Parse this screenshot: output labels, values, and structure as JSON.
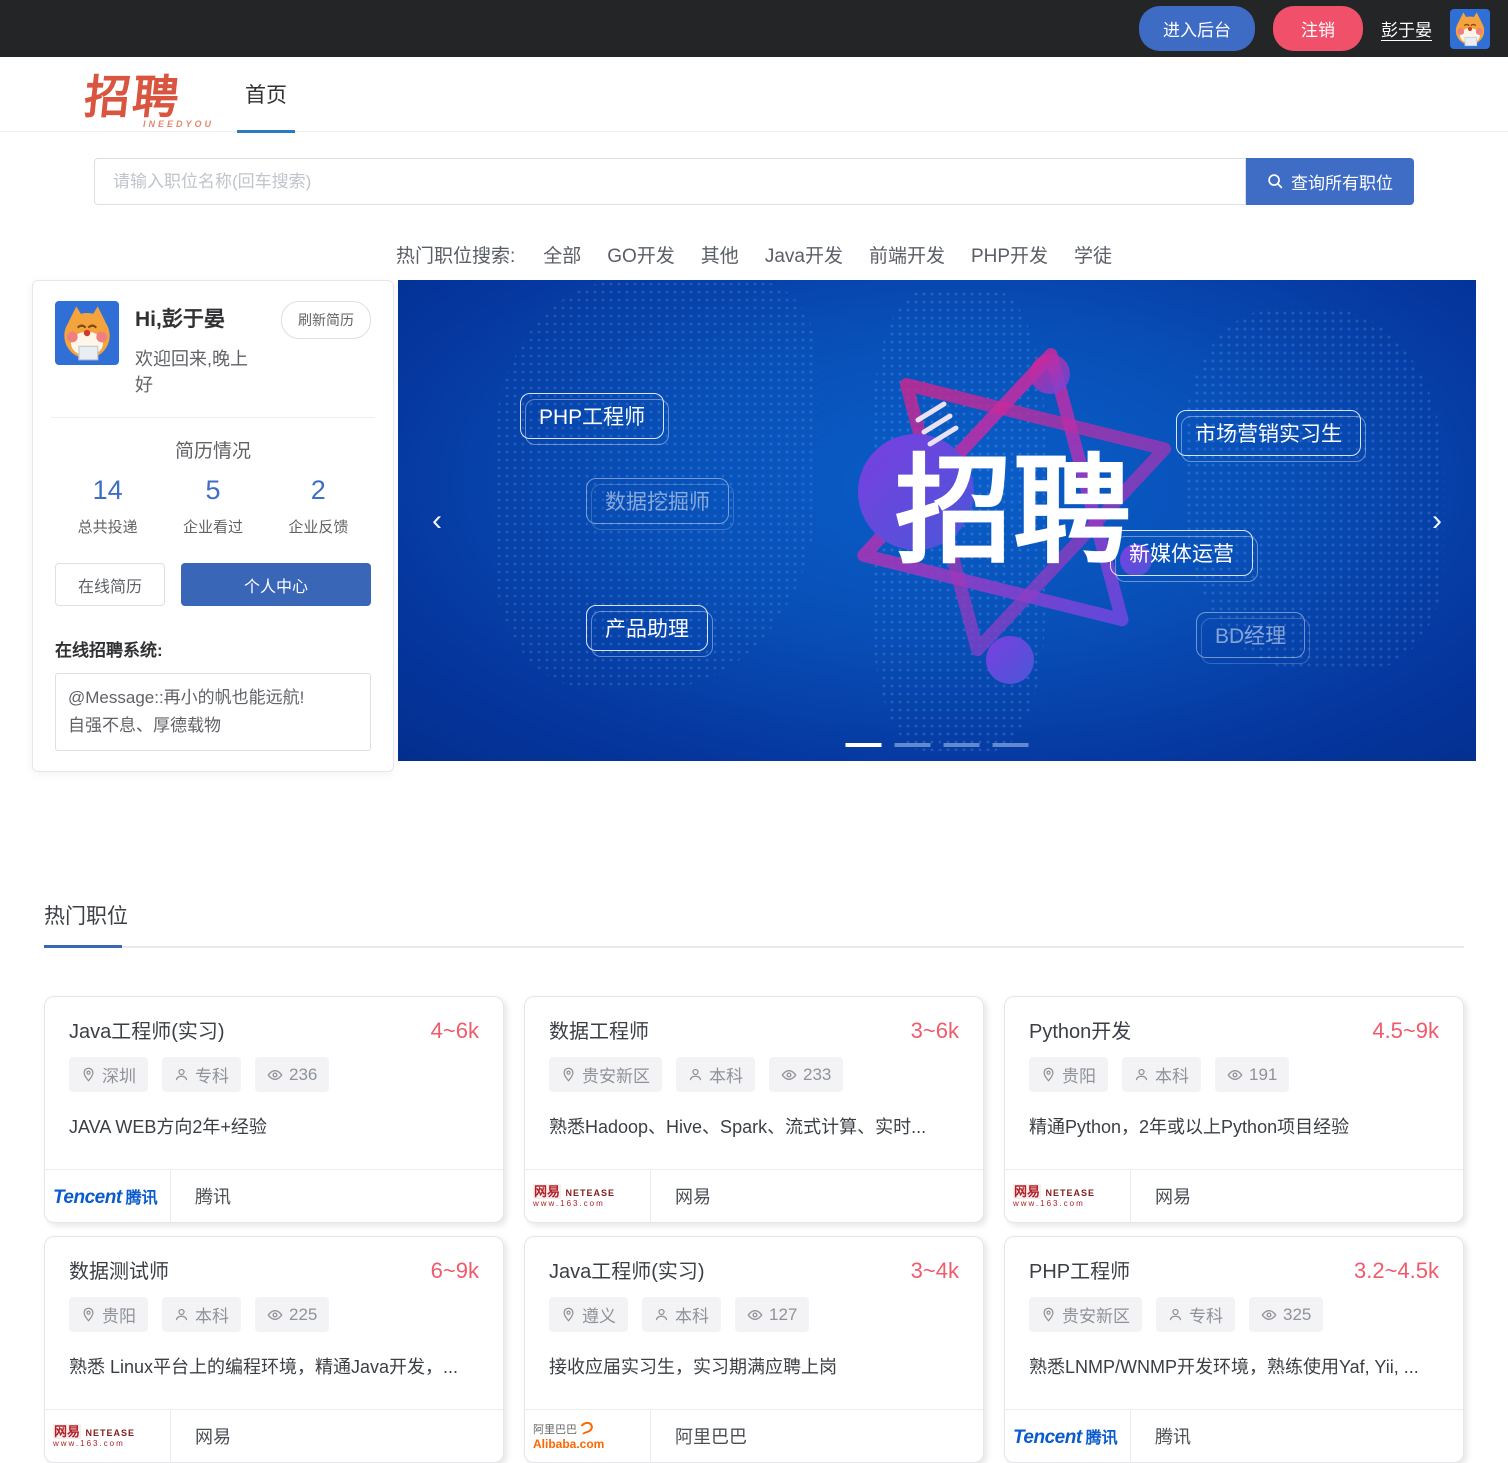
{
  "topbar": {
    "admin_button": "进入后台",
    "logout_button": "注销",
    "username": "彭于晏"
  },
  "header": {
    "logo_text": "招聘",
    "logo_sub": "INEEDYOU",
    "nav_home": "首页"
  },
  "search": {
    "placeholder": "请输入职位名称(回车搜索)",
    "button": "查询所有职位"
  },
  "hot_search": {
    "label": "热门职位搜索:",
    "items": [
      "全部",
      "GO开发",
      "其他",
      "Java开发",
      "前端开发",
      "PHP开发",
      "学徒"
    ]
  },
  "user_card": {
    "greeting": "Hi,彭于晏",
    "refresh_button": "刷新简历",
    "welcome": "欢迎回来,晚上好",
    "resume_title": "简历情况",
    "stats": [
      {
        "value": "14",
        "label": "总共投递"
      },
      {
        "value": "5",
        "label": "企业看过"
      },
      {
        "value": "2",
        "label": "企业反馈"
      }
    ],
    "online_resume_button": "在线简历",
    "personal_center_button": "个人中心",
    "system_label": "在线招聘系统:",
    "message_line1": "@Message::再小的帆也能远航!",
    "message_line2": "自强不息、厚德载物"
  },
  "banner": {
    "main_text": "招聘",
    "labels": [
      "PHP工程师",
      "数据挖掘师",
      "产品助理",
      "市场营销实习生",
      "新媒体运营",
      "BD经理"
    ],
    "prev_arrow": "‹",
    "next_arrow": "›",
    "dots_count": 4,
    "active_dot": 0
  },
  "jobs_section": {
    "title": "热门职位",
    "cards": [
      {
        "title": "Java工程师(实习)",
        "salary": "4~6k",
        "location": "深圳",
        "education": "专科",
        "views": "236",
        "desc": "JAVA WEB方向2年+经验",
        "company": "腾讯",
        "logo": "tencent"
      },
      {
        "title": "数据工程师",
        "salary": "3~6k",
        "location": "贵安新区",
        "education": "本科",
        "views": "233",
        "desc": "熟悉Hadoop、Hive、Spark、流式计算、实时...",
        "company": "网易",
        "logo": "netease"
      },
      {
        "title": "Python开发",
        "salary": "4.5~9k",
        "location": "贵阳",
        "education": "本科",
        "views": "191",
        "desc": "精通Python，2年或以上Python项目经验",
        "company": "网易",
        "logo": "netease"
      },
      {
        "title": "数据测试师",
        "salary": "6~9k",
        "location": "贵阳",
        "education": "本科",
        "views": "225",
        "desc": "熟悉 Linux平台上的编程环境，精通Java开发，...",
        "company": "网易",
        "logo": "netease"
      },
      {
        "title": "Java工程师(实习)",
        "salary": "3~4k",
        "location": "遵义",
        "education": "本科",
        "views": "127",
        "desc": "接收应届实习生，实习期满应聘上岗",
        "company": "阿里巴巴",
        "logo": "alibaba"
      },
      {
        "title": "PHP工程师",
        "salary": "3.2~4.5k",
        "location": "贵安新区",
        "education": "专科",
        "views": "325",
        "desc": "熟悉LNMP/WNMP开发环境，熟练使用Yaf, Yii, ...",
        "company": "腾讯",
        "logo": "tencent"
      }
    ]
  },
  "logos": {
    "tencent": {
      "en": "Tencent",
      "cn": "腾讯"
    },
    "netease": {
      "cn": "网易",
      "en": "NETEASE",
      "sub": "www.163.com"
    },
    "alibaba": {
      "cn": "阿里巴巴",
      "en": "Alibaba.com"
    }
  },
  "colors": {
    "primary_blue": "#3f6dc6",
    "danger_red": "#f0506a",
    "salary_red": "#f05a6b",
    "banner_blue": "#0850b8",
    "logo_red": "#d9553f"
  }
}
